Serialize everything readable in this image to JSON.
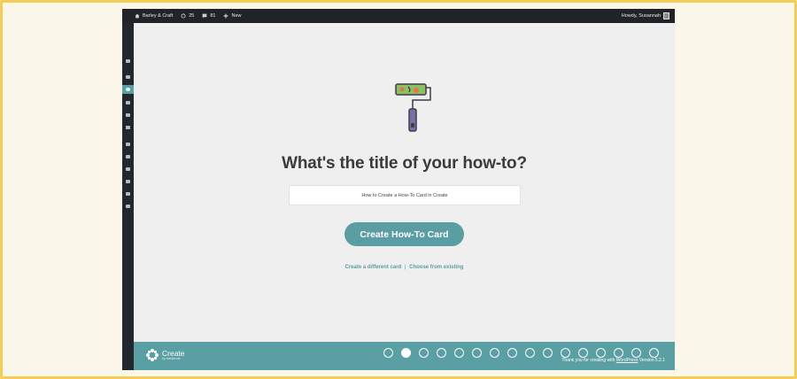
{
  "adminbar": {
    "site_name": "Barley & Craft",
    "updates_count": "25",
    "comments_count": "81",
    "new_label": "New",
    "greeting": "Howdy, Susannah"
  },
  "main": {
    "heading": "What's the title of your how-to?",
    "title_input_value": "How to Create a How-To Card in Create",
    "create_button_label": "Create How-To Card",
    "different_card_link": "Create a different card",
    "separator": "|",
    "choose_existing_link": "Choose from existing"
  },
  "footer": {
    "brand_name": "Create",
    "brand_sub": "by mediavine",
    "thanks_prefix": "Thank you for creating with",
    "wordpress_link": "WordPress",
    "version_text": "Version 5.2.1"
  },
  "steps": {
    "total": 16,
    "active_index": 1
  },
  "colors": {
    "accent": "#5a9ea4",
    "adminbar": "#202428",
    "sidebar": "#22272b",
    "frame_border": "#f3cd55"
  }
}
